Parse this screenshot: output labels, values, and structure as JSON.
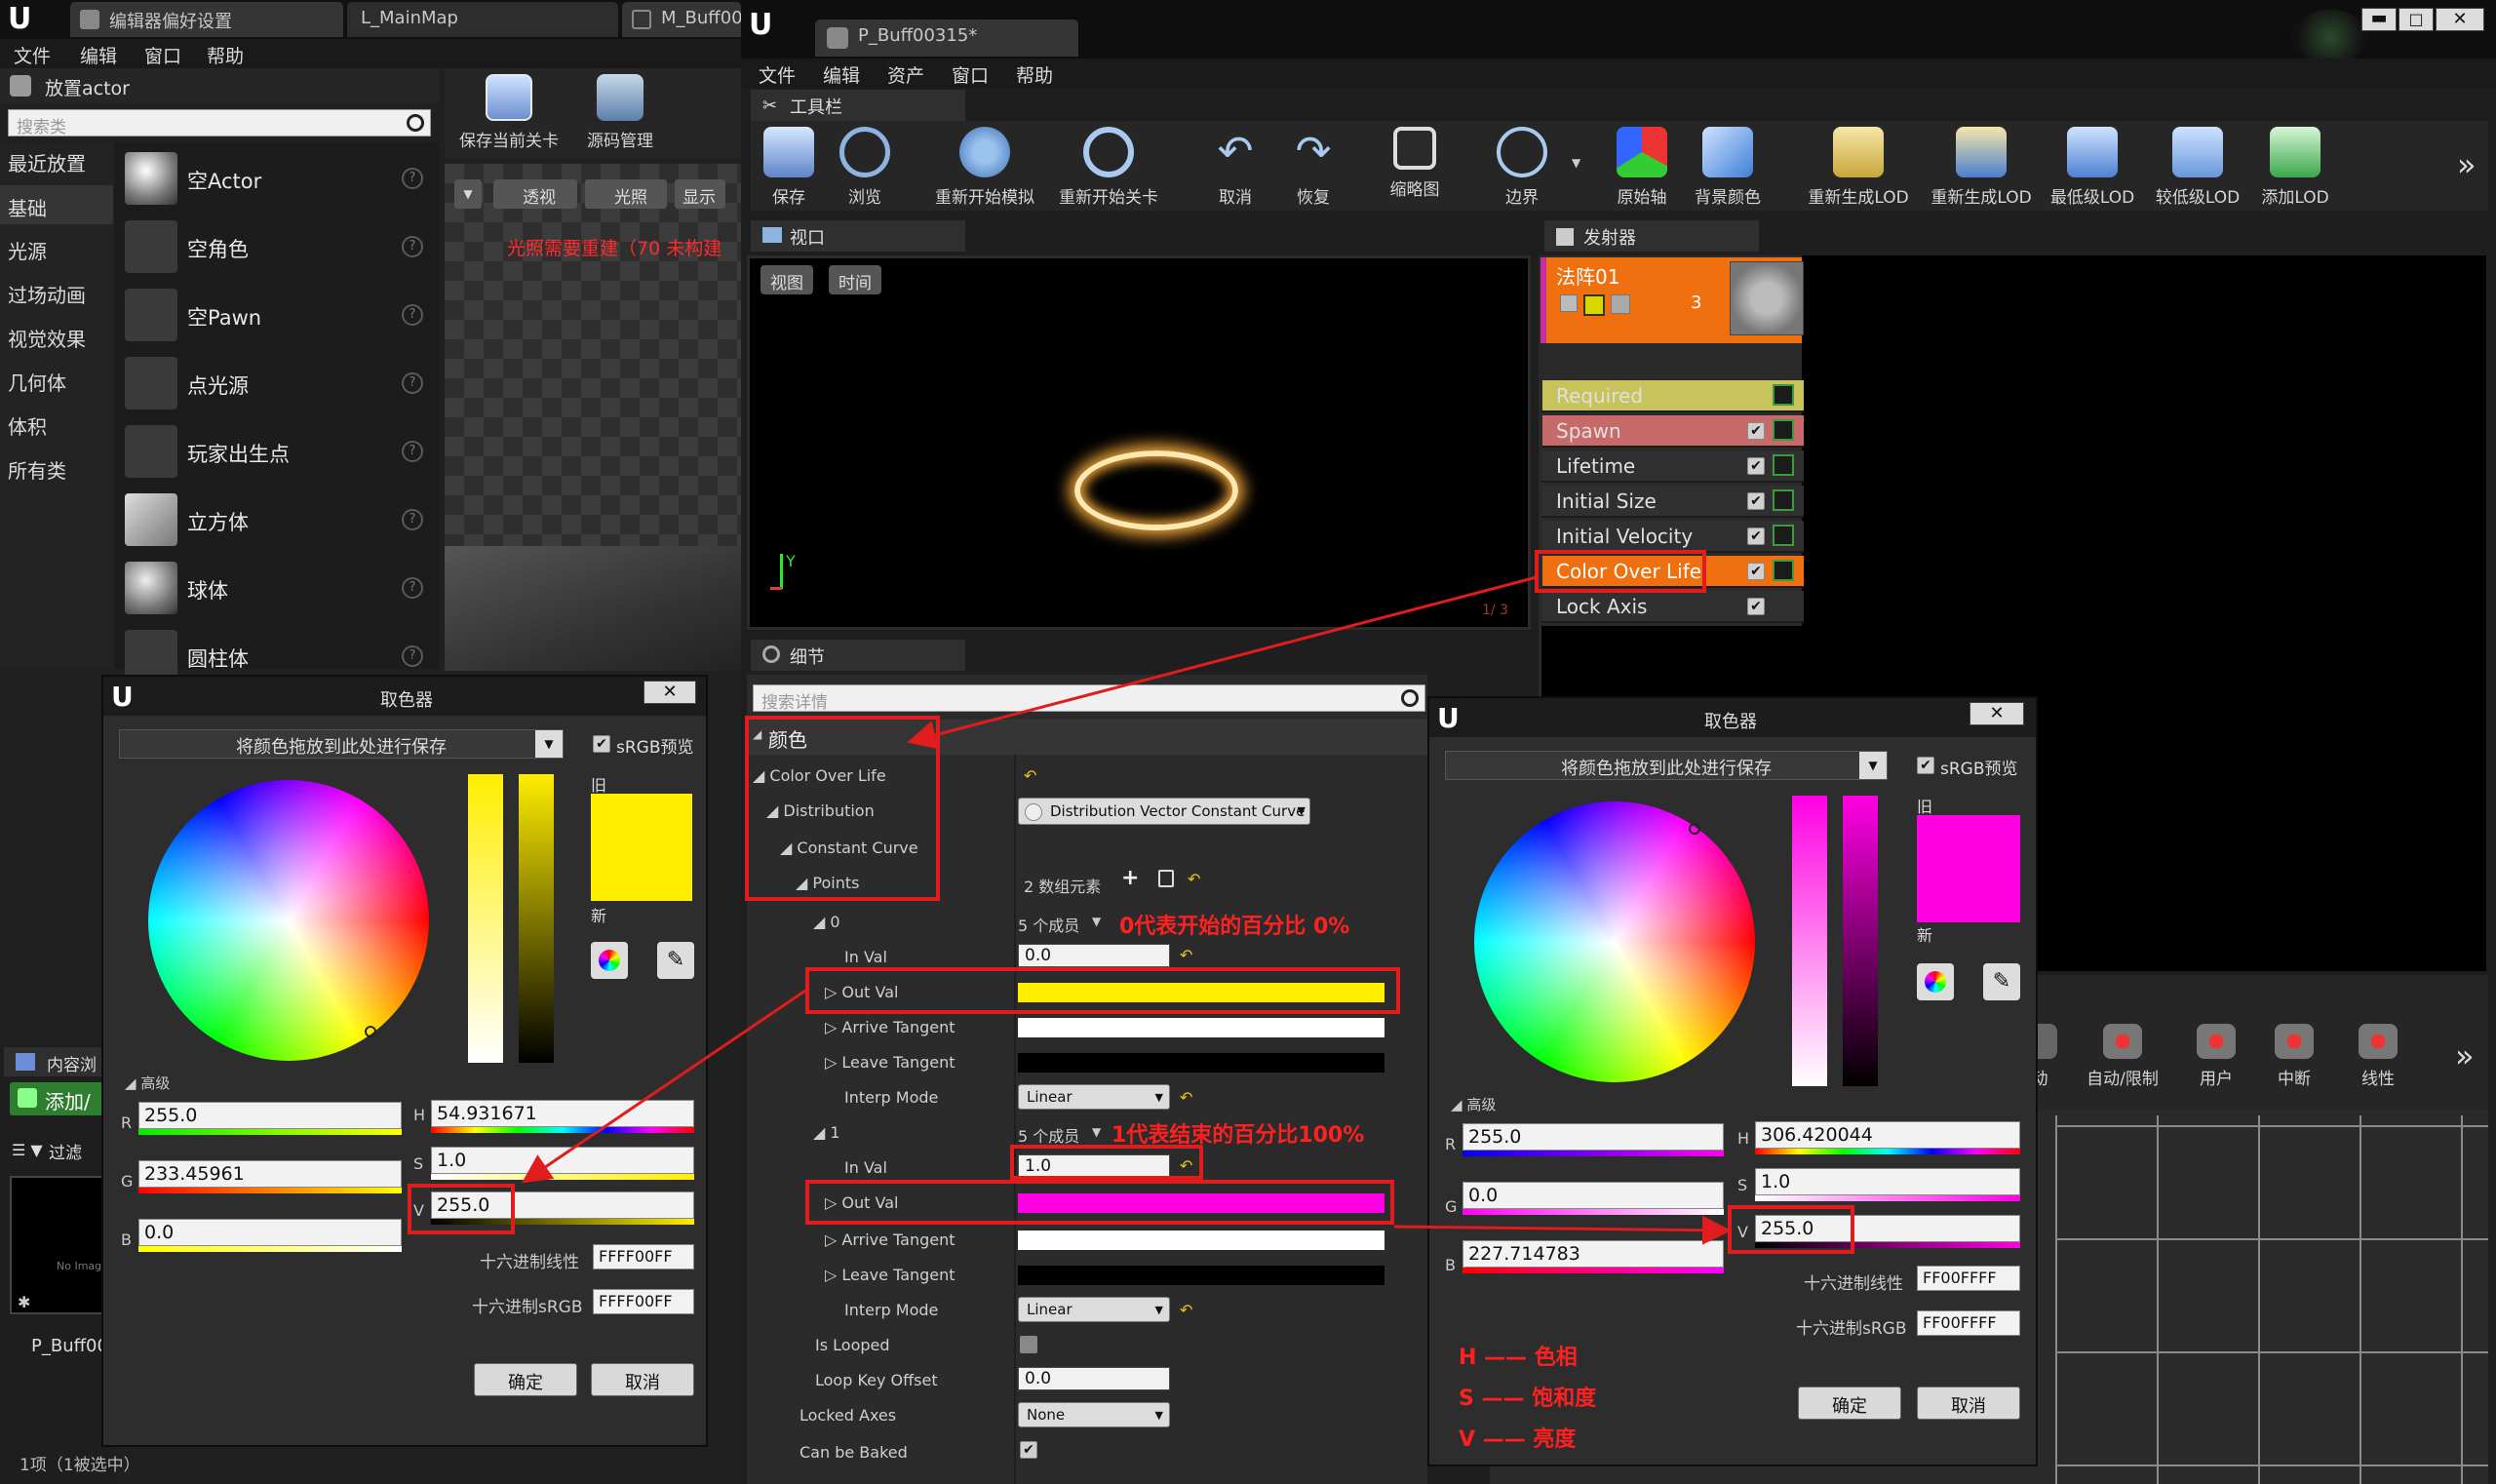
{
  "left_editor": {
    "tabs": [
      "编辑器偏好设置",
      "L_MainMap",
      "M_Buff00"
    ],
    "menu": [
      "文件",
      "编辑",
      "窗口",
      "帮助"
    ],
    "place_actor_title": "放置actor",
    "search_placeholder": "搜索类",
    "toolbar": [
      {
        "label": "保存当前关卡",
        "icon": "save-icon"
      },
      {
        "label": "源码管理",
        "icon": "source-control-icon"
      }
    ],
    "categories": [
      "最近放置",
      "基础",
      "光源",
      "过场动画",
      "视觉效果",
      "几何体",
      "体积",
      "所有类"
    ],
    "selected_category": "基础",
    "items": [
      "空Actor",
      "空角色",
      "空Pawn",
      "点光源",
      "玩家出生点",
      "立方体",
      "球体",
      "圆柱体"
    ],
    "viewport_buttons": [
      "透视",
      "光照",
      "显示"
    ],
    "lighting_warning": "光照需要重建（70 未构建",
    "content_browser_tab": "内容浏",
    "add_button": "添加/",
    "filter_label": "过滤",
    "asset_name": "P_Buff00",
    "no_image": "No Imag",
    "status": "1项（1被选中）"
  },
  "cascade": {
    "tab": "P_Buff00315*",
    "menu": [
      "文件",
      "编辑",
      "资产",
      "窗口",
      "帮助"
    ],
    "toolbar_panel": "工具栏",
    "toolbar": [
      {
        "label": "保存",
        "icon": "save-icon"
      },
      {
        "label": "浏览",
        "icon": "browse-icon"
      },
      {
        "label": "重新开始模拟",
        "icon": "restart-sim-icon"
      },
      {
        "label": "重新开始关卡",
        "icon": "restart-level-icon"
      },
      {
        "label": "取消",
        "icon": "undo-icon"
      },
      {
        "label": "恢复",
        "icon": "redo-icon"
      },
      {
        "label": "缩略图",
        "icon": "thumbnail-icon"
      },
      {
        "label": "边界",
        "icon": "bounds-icon"
      },
      {
        "label": "原始轴",
        "icon": "axis-icon"
      },
      {
        "label": "背景颜色",
        "icon": "bg-color-icon"
      },
      {
        "label": "重新生成LOD",
        "icon": "regen-lod-icon"
      },
      {
        "label": "重新生成LOD",
        "icon": "regen-lod-icon-2"
      },
      {
        "label": "最低级LOD",
        "icon": "lowest-lod-icon"
      },
      {
        "label": "较低级LOD",
        "icon": "lower-lod-icon"
      },
      {
        "label": "添加LOD",
        "icon": "add-lod-icon"
      }
    ],
    "viewport_panel": "视口",
    "viewport_buttons": [
      "视图",
      "时间"
    ],
    "axis_y": "Y",
    "viewport_counter": "1/ 3",
    "emitter_panel": "发射器",
    "emitter_name": "法阵01",
    "emitter_count": "3",
    "modules": [
      {
        "name": "Required",
        "color": "#c8c35a"
      },
      {
        "name": "Spawn",
        "color": "#c86a6a"
      },
      {
        "name": "Lifetime",
        "color": "#303030"
      },
      {
        "name": "Initial Size",
        "color": "#303030"
      },
      {
        "name": "Initial Velocity",
        "color": "#303030"
      },
      {
        "name": "Color Over Life",
        "color": "#f07010"
      },
      {
        "name": "Lock Axis",
        "color": "#303030"
      }
    ],
    "curve_toolbar": [
      {
        "label": "动",
        "icon": "auto-icon"
      },
      {
        "label": "自动/限制",
        "icon": "auto-clamp-icon"
      },
      {
        "label": "用户",
        "icon": "user-icon"
      },
      {
        "label": "中断",
        "icon": "break-icon"
      },
      {
        "label": "线性",
        "icon": "linear-icon"
      }
    ],
    "details_panel": "细节",
    "details_search_placeholder": "搜索详情",
    "details": {
      "category": "颜色",
      "color_over_life": "Color Over Life",
      "distribution": "Distribution",
      "distribution_value": "Distribution Vector Constant Curve",
      "constant_curve": "Constant Curve",
      "points": "Points",
      "points_count": "2 数组元素",
      "p0_index": "0",
      "p0_members": "5 个成员",
      "p0_note": "0代表开始的百分比 0%",
      "in_val_label": "In Val",
      "p0_in_val": "0.0",
      "out_val_label": "Out Val",
      "arrive_tangent": "Arrive Tangent",
      "leave_tangent": "Leave Tangent",
      "interp_mode": "Interp Mode",
      "interp_value": "Linear",
      "p1_index": "1",
      "p1_members": "5 个成员",
      "p1_note": "1代表结束的百分比100%",
      "p1_in_val": "1.0",
      "is_looped": "Is Looped",
      "loop_key_offset": "Loop Key Offset",
      "loop_key_value": "0.0",
      "locked_axes": "Locked Axes",
      "locked_axes_value": "None",
      "can_be_baked": "Can be Baked",
      "p0_color": "#ffee00",
      "p1_color": "#ff00e3"
    }
  },
  "picker_left": {
    "title": "取色器",
    "save_hint": "将颜色拖放到此处进行保存",
    "srgb": "sRGB预览",
    "old_label": "旧",
    "new_label": "新",
    "advanced": "高级",
    "r_label": "R",
    "r": "255.0",
    "g_label": "G",
    "g": "233.45961",
    "b_label": "B",
    "b": "0.0",
    "h_label": "H",
    "h": "54.931671",
    "s_label": "S",
    "s": "1.0",
    "v_label": "V",
    "v": "255.0",
    "hex_linear_label": "十六进制线性",
    "hex_linear": "FFFF00FF",
    "hex_srgb_label": "十六进制sRGB",
    "hex_srgb": "FFFF00FF",
    "ok": "确定",
    "cancel": "取消",
    "color": "#ffee00"
  },
  "picker_right": {
    "title": "取色器",
    "save_hint": "将颜色拖放到此处进行保存",
    "srgb": "sRGB预览",
    "old_label": "旧",
    "new_label": "新",
    "advanced": "高级",
    "r_label": "R",
    "r": "255.0",
    "g_label": "G",
    "g": "0.0",
    "b_label": "B",
    "b": "227.714783",
    "h_label": "H",
    "h": "306.420044",
    "s_label": "S",
    "s": "1.0",
    "v_label": "V",
    "v": "255.0",
    "hex_linear_label": "十六进制线性",
    "hex_linear": "FF00FFFF",
    "hex_srgb_label": "十六进制sRGB",
    "hex_srgb": "FF00FFFF",
    "ok": "确定",
    "cancel": "取消",
    "color": "#ff00e3"
  },
  "legend": [
    {
      "key": "H",
      "text": "色相"
    },
    {
      "key": "S",
      "text": "饱和度"
    },
    {
      "key": "V",
      "text": "亮度"
    }
  ]
}
